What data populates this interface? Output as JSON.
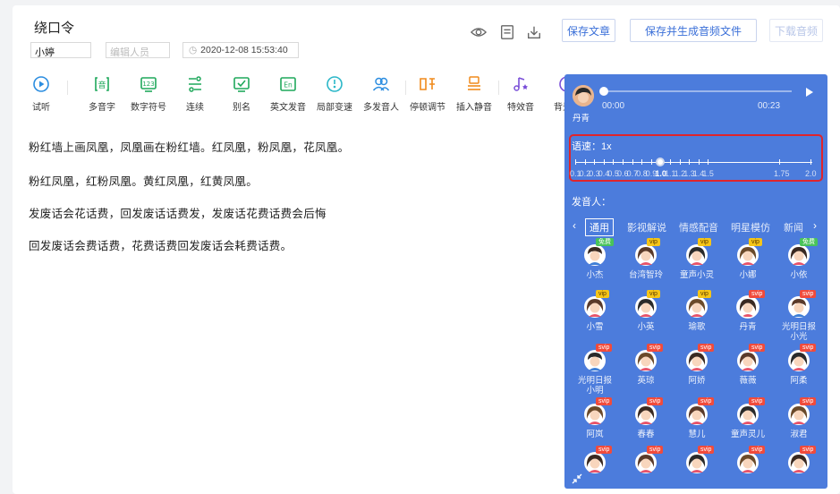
{
  "document": {
    "title": "绕口令",
    "author": "小婷",
    "editor_placeholder": "编辑人员",
    "datetime": "2020-12-08 15:53:40"
  },
  "header_icons": [
    "eye-icon",
    "save-doc-icon",
    "download-icon"
  ],
  "buttons": {
    "save": "保存文章",
    "save_generate": "保存并生成音频文件",
    "download": "下载音频"
  },
  "toolbar": [
    {
      "label": "试听",
      "icon": "play-circle-icon"
    },
    {
      "label": "多音字",
      "icon": "polyphone-icon"
    },
    {
      "label": "数字符号",
      "icon": "number-icon"
    },
    {
      "label": "连续",
      "icon": "continuous-icon"
    },
    {
      "label": "别名",
      "icon": "alias-icon"
    },
    {
      "label": "英文发音",
      "icon": "english-icon"
    },
    {
      "label": "局部变速",
      "icon": "local-speed-icon"
    },
    {
      "label": "多发音人",
      "icon": "multi-speaker-icon"
    },
    {
      "label": "停顿调节",
      "icon": "pause-icon"
    },
    {
      "label": "插入静音",
      "icon": "silence-icon"
    },
    {
      "label": "特效音",
      "icon": "sound-effect-icon"
    },
    {
      "label": "背景音",
      "icon": "background-music-icon"
    }
  ],
  "paragraphs": [
    "粉红墙上画凤凰，凤凰画在粉红墙。红凤凰，粉凤凰，花凤凰。",
    "粉红凤凰，红粉凤凰。黄红凤凰，红黄凤凰。",
    "发废话会花话费，回发废话话费发，发废话花费话费会后悔",
    "回发废话会费话费，花费话费回发废话会耗费话费。"
  ],
  "panel": {
    "current_speaker": "丹青",
    "time_start": "00:00",
    "time_end": "00:23",
    "progress": 0.0,
    "speed_label": "语速：1x",
    "speed_value": 1.0,
    "speed_ticks": [
      "0.1",
      "0.2",
      "0.3",
      "0.4",
      "0.5",
      "0.6",
      "0.7",
      "0.8",
      "0.9",
      "1.0",
      "1.1",
      "1.2",
      "1.3",
      "1.4",
      "1.5",
      "1.75",
      "2.0"
    ],
    "voice_title": "发音人：",
    "categories": [
      "通用",
      "影视解说",
      "情感配音",
      "明星模仿",
      "新闻"
    ],
    "active_category": "通用",
    "voices": [
      {
        "name": "小杰",
        "badge": "免费",
        "gender": "m"
      },
      {
        "name": "台湾智玲",
        "badge": "vip",
        "gender": "f"
      },
      {
        "name": "童声小灵",
        "badge": "vip",
        "gender": "f"
      },
      {
        "name": "小娜",
        "badge": "vip",
        "gender": "f"
      },
      {
        "name": "小依",
        "badge": "免费",
        "gender": "f"
      },
      {
        "name": "小雪",
        "badge": "vip",
        "gender": "f"
      },
      {
        "name": "小英",
        "badge": "vip",
        "gender": "f"
      },
      {
        "name": "瑜歌",
        "badge": "vip",
        "gender": "f"
      },
      {
        "name": "丹青",
        "badge": "svip",
        "gender": "f",
        "selected": true
      },
      {
        "name": "光明日报小光",
        "badge": "svip",
        "gender": "m"
      },
      {
        "name": "光明日报小明",
        "badge": "svip",
        "gender": "m"
      },
      {
        "name": "英琼",
        "badge": "svip",
        "gender": "f"
      },
      {
        "name": "阿娇",
        "badge": "svip",
        "gender": "f"
      },
      {
        "name": "薇薇",
        "badge": "svip",
        "gender": "f"
      },
      {
        "name": "阿柔",
        "badge": "svip",
        "gender": "f"
      },
      {
        "name": "阿岚",
        "badge": "svip",
        "gender": "f"
      },
      {
        "name": "春春",
        "badge": "svip",
        "gender": "f"
      },
      {
        "name": "慧儿",
        "badge": "svip",
        "gender": "f"
      },
      {
        "name": "童声灵儿",
        "badge": "svip",
        "gender": "f"
      },
      {
        "name": "淑君",
        "badge": "svip",
        "gender": "f"
      },
      {
        "name": "",
        "badge": "svip",
        "gender": "f"
      },
      {
        "name": "",
        "badge": "svip",
        "gender": "f"
      },
      {
        "name": "",
        "badge": "svip",
        "gender": "f"
      },
      {
        "name": "",
        "badge": "svip",
        "gender": "f"
      },
      {
        "name": "",
        "badge": "svip",
        "gender": "f"
      }
    ]
  },
  "colors": {
    "accent": "#3a6fd8",
    "toolbar_green": "#1fa85b",
    "toolbar_blue": "#2b8de0",
    "toolbar_orange": "#f08a1c",
    "panel_bg": "#4c7cdc",
    "highlight_red": "#e0242b",
    "badge_free": "#48c35a",
    "badge_vip": "#f5c518",
    "badge_svip": "#f04b3c"
  }
}
